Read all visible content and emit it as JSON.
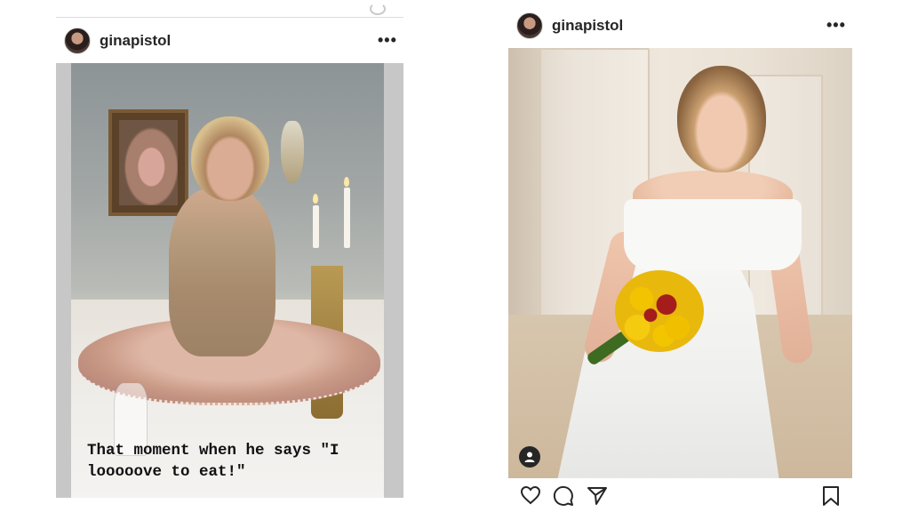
{
  "left_post": {
    "username": "ginapistol",
    "more_label": "•••",
    "caption": "That moment when he says \"I looooove to eat!\""
  },
  "right_post": {
    "username": "ginapistol",
    "more_label": "•••"
  },
  "icons": {
    "avatar": "profile-photo",
    "like": "heart-icon",
    "comment": "comment-icon",
    "share": "paper-plane-icon",
    "save": "bookmark-icon",
    "user_tag": "user-icon"
  },
  "colors": {
    "text": "#262626",
    "border": "#dbdbdb"
  }
}
